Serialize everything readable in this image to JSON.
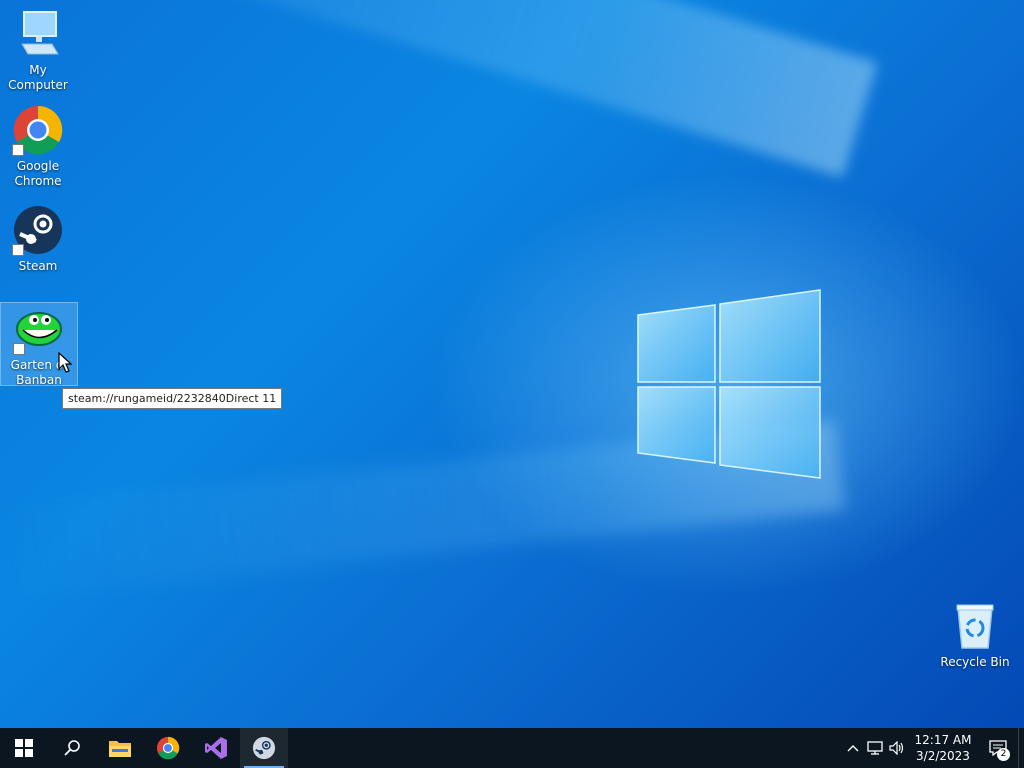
{
  "desktop": {
    "icons": [
      {
        "label": "My Computer",
        "icon": "computer-icon"
      },
      {
        "label": "Google\nChrome",
        "icon": "chrome-icon"
      },
      {
        "label": "Steam",
        "icon": "steam-icon"
      },
      {
        "label": "Garten of\nBanban",
        "icon": "garten-of-banban-icon"
      },
      {
        "label": "Recycle Bin",
        "icon": "recycle-bin-icon"
      }
    ],
    "tooltip": "steam://rungameid/2232840Direct 11"
  },
  "taskbar": {
    "buttons": [
      "start-icon",
      "search-icon",
      "file-explorer-icon",
      "chrome-icon",
      "visual-studio-icon",
      "steam-icon"
    ],
    "active": "steam-icon",
    "clock": {
      "time": "12:17 AM",
      "date": "3/2/2023"
    },
    "notifications": "2"
  },
  "colors": {
    "accent": "#0a74d8",
    "taskbar": "#0b1620"
  }
}
